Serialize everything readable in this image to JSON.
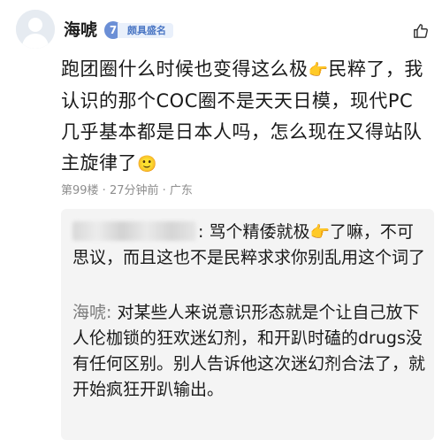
{
  "comment": {
    "author": "海唬",
    "level": "7",
    "title_badge": "颇具盛名",
    "body_part1": "跑团圈什么时候也变得这么极",
    "emoji1": "👉",
    "body_part2": "民粹了，我认识的那个COC圈不是天天日模，现代PC几乎基本都是日本人吗，怎么现在又得站队主旋律了",
    "emoji2": "🙂",
    "floor": "第99楼",
    "time": "27分钟前",
    "location": "广东"
  },
  "replies": [
    {
      "author": "",
      "text_part1": ": 骂个精倭就极",
      "emoji": "👉",
      "text_part2": "了嘛，不可思议，而且这也不是民粹求求你别乱用这个词了"
    },
    {
      "author": "海唬:",
      "text": " 对某些人来说意识形态就是个让自己放下人伦枷锁的狂欢迷幻剂，和开趴时磕的drugs没有任何区别。别人告诉他这次迷幻剂合法了，就开始疯狂开趴输出。"
    }
  ],
  "icons": {
    "avatar": "default-avatar-icon",
    "like": "thumbs-up-icon"
  },
  "colors": {
    "level_badge": "#6b8fd6",
    "title_badge_text": "#4a76c4",
    "meta_text": "#8e8e8e"
  }
}
